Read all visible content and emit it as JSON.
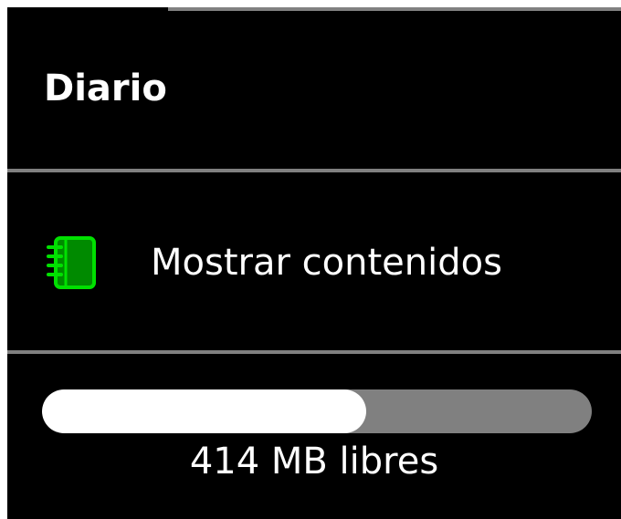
{
  "palette": {
    "title": "Diario",
    "menu_item": {
      "label": "Mostrar contenidos",
      "icon": "notebook-icon",
      "icon_color": "#00d000"
    },
    "storage": {
      "text": "414 MB libres",
      "used_fraction": 0.59
    }
  },
  "colors": {
    "background": "#000000",
    "text": "#ffffff",
    "divider": "#808080"
  }
}
